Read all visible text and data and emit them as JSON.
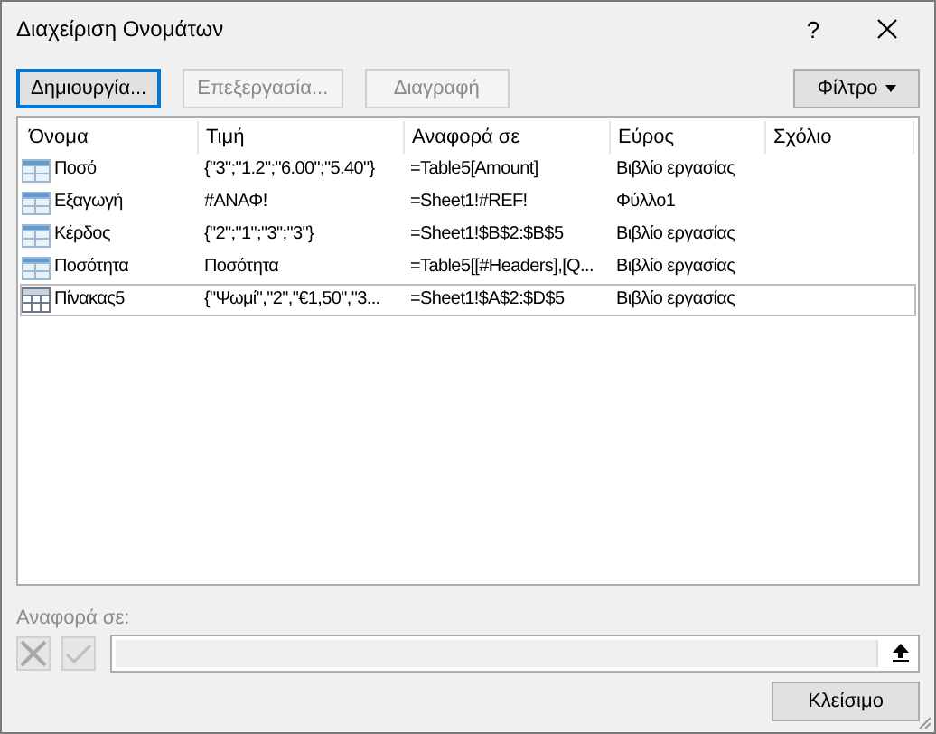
{
  "window": {
    "title": "Διαχείριση Ονομάτων",
    "help": "?"
  },
  "toolbar": {
    "buttons": [
      {
        "label": "Δημιουργία...",
        "disabled": false,
        "focused": true
      },
      {
        "label": "Επεξεργασία...",
        "disabled": true,
        "focused": false
      },
      {
        "label": "Διαγραφή",
        "disabled": true,
        "focused": false
      }
    ],
    "filter": {
      "label": "Φίλτρο"
    }
  },
  "table": {
    "columns": [
      "Όνομα",
      "Τιμή",
      "Αναφορά σε",
      "Εύρος",
      "Σχόλιο"
    ],
    "rows": [
      {
        "kind": "name",
        "selected": false,
        "cells": [
          "Ποσό",
          "{\"3\";\"1.2\";\"6.00\";\"5.40\"}",
          "=Table5[Amount]",
          "Βιβλίο εργασίας",
          ""
        ]
      },
      {
        "kind": "name",
        "selected": false,
        "cells": [
          "Εξαγωγή",
          "#ΑΝΑΦ!",
          "=Sheet1!#REF!",
          "Φύλλο1",
          ""
        ]
      },
      {
        "kind": "name",
        "selected": false,
        "cells": [
          "Κέρδος",
          "{\"2\";\"1\";\"3\";\"3\"}",
          "=Sheet1!$B$2:$B$5",
          "Βιβλίο εργασίας",
          ""
        ]
      },
      {
        "kind": "name",
        "selected": false,
        "cells": [
          "Ποσότητα",
          "Ποσότητα",
          "=Table5[[#Headers],[Q...",
          "Βιβλίο εργασίας",
          ""
        ]
      },
      {
        "kind": "table",
        "selected": true,
        "cells": [
          "Πίνακας5",
          "{\"Ψωμί\",\"2\",\"€1,50\",\"3...",
          "=Sheet1!$A$2:$D$5",
          "Βιβλίο εργασίας",
          ""
        ]
      }
    ]
  },
  "refers_to": {
    "label": "Αναφορά σε:",
    "disabled": true
  },
  "footer": {
    "close": "Κλείσιμο"
  }
}
